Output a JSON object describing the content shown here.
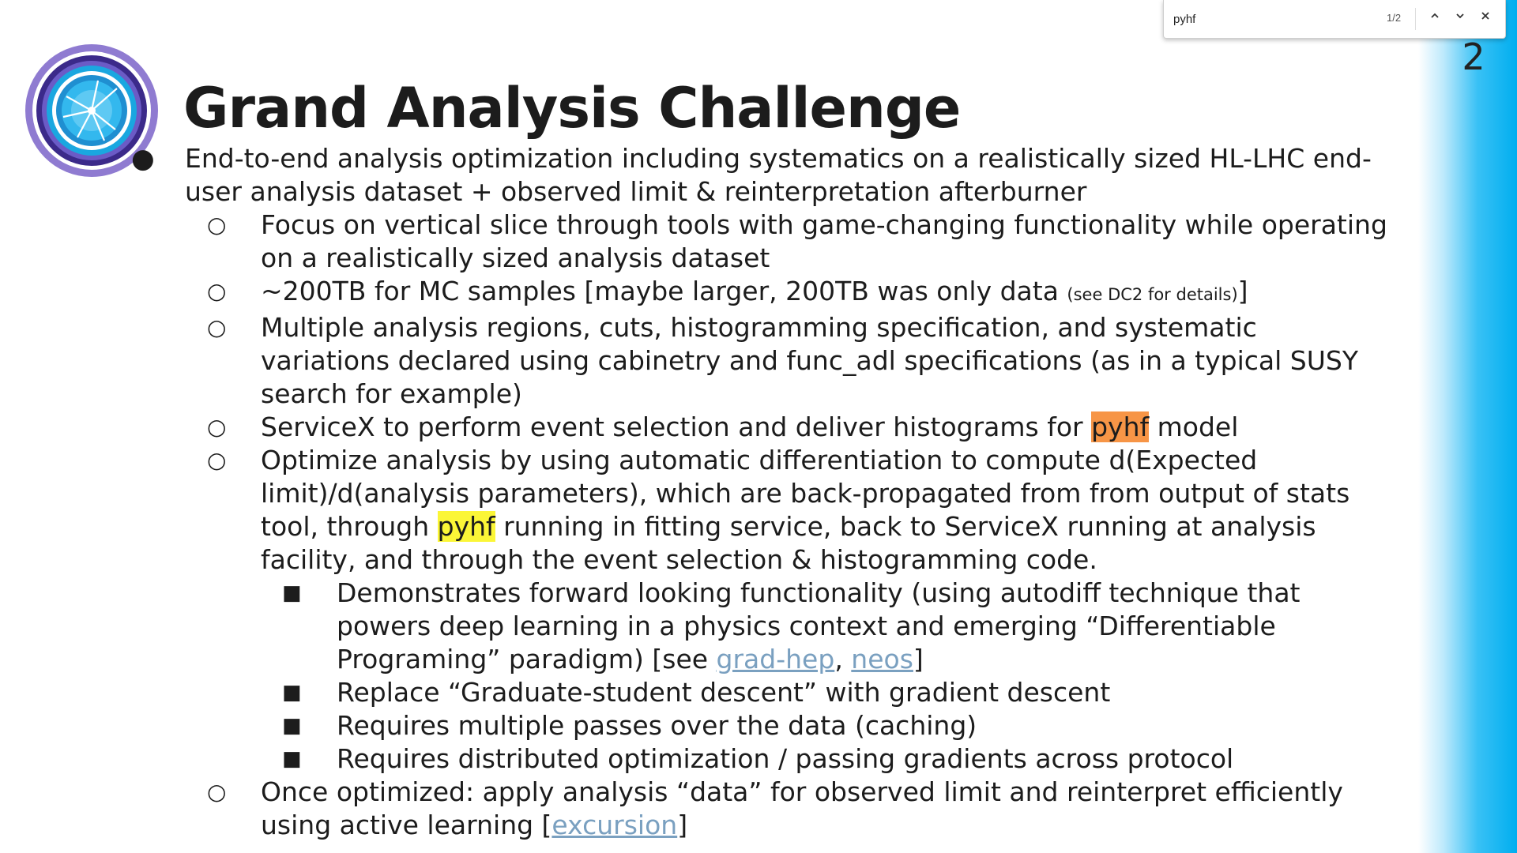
{
  "slide": {
    "number": "2",
    "title": "Grand Analysis Challenge"
  },
  "find_bar": {
    "query": "pyhf",
    "count": "1/2",
    "prev_icon": "chevron-up-icon",
    "next_icon": "chevron-down-icon",
    "close_icon": "close-icon"
  },
  "colors": {
    "current_match_highlight": "#f79546",
    "match_highlight": "#fbf637",
    "link": "#7aa0c0",
    "side_gradient_end": "#00aeef"
  },
  "bullets": {
    "b1": "End-to-end analysis optimization including systematics on a realistically sized HL-LHC end-user analysis dataset + observed limit & reinterpretation afterburner",
    "s1": "Focus on vertical slice through tools with game-changing functionality while operating on a realistically sized analysis dataset",
    "s2_main": "~200TB for MC samples  [maybe larger, 200TB was only data ",
    "s2_small": "(see DC2 for details)",
    "s2_end": "]",
    "s3": "Multiple analysis regions, cuts, histogramming specification, and systematic variations declared using cabinetry and func_adl specifications (as in a typical SUSY search for example)",
    "s4_pre": "ServiceX to perform event selection and deliver histograms for ",
    "s4_hl": "pyhf",
    "s4_post": " model",
    "s5_pre": "Optimize analysis by using automatic differentiation to compute d(Expected limit)/d(analysis parameters), which are back-propagated from from output of stats tool, through ",
    "s5_hl": "pyhf",
    "s5_post": " running in fitting service, back to ServiceX running at analysis facility, and through the event selection & histogramming code.",
    "t1_pre": "Demonstrates forward looking functionality (using autodiff technique that powers deep learning in a physics context and emerging “Differentiable Programing” paradigm) [see ",
    "t1_link1": "grad-hep",
    "t1_sep": ", ",
    "t1_link2": "neos",
    "t1_end": "]",
    "t2": "Replace “Graduate-student descent” with gradient descent",
    "t3": "Requires multiple passes over the data (caching)",
    "t4": "Requires distributed optimization / passing gradients across protocol",
    "s6_pre": "Once optimized: apply analysis “data” for observed limit and reinterpret efficiently using active learning [",
    "s6_link": "excursion",
    "s6_end": "]"
  },
  "markers": {
    "level0": "●",
    "level1": "○",
    "level2": "■"
  }
}
